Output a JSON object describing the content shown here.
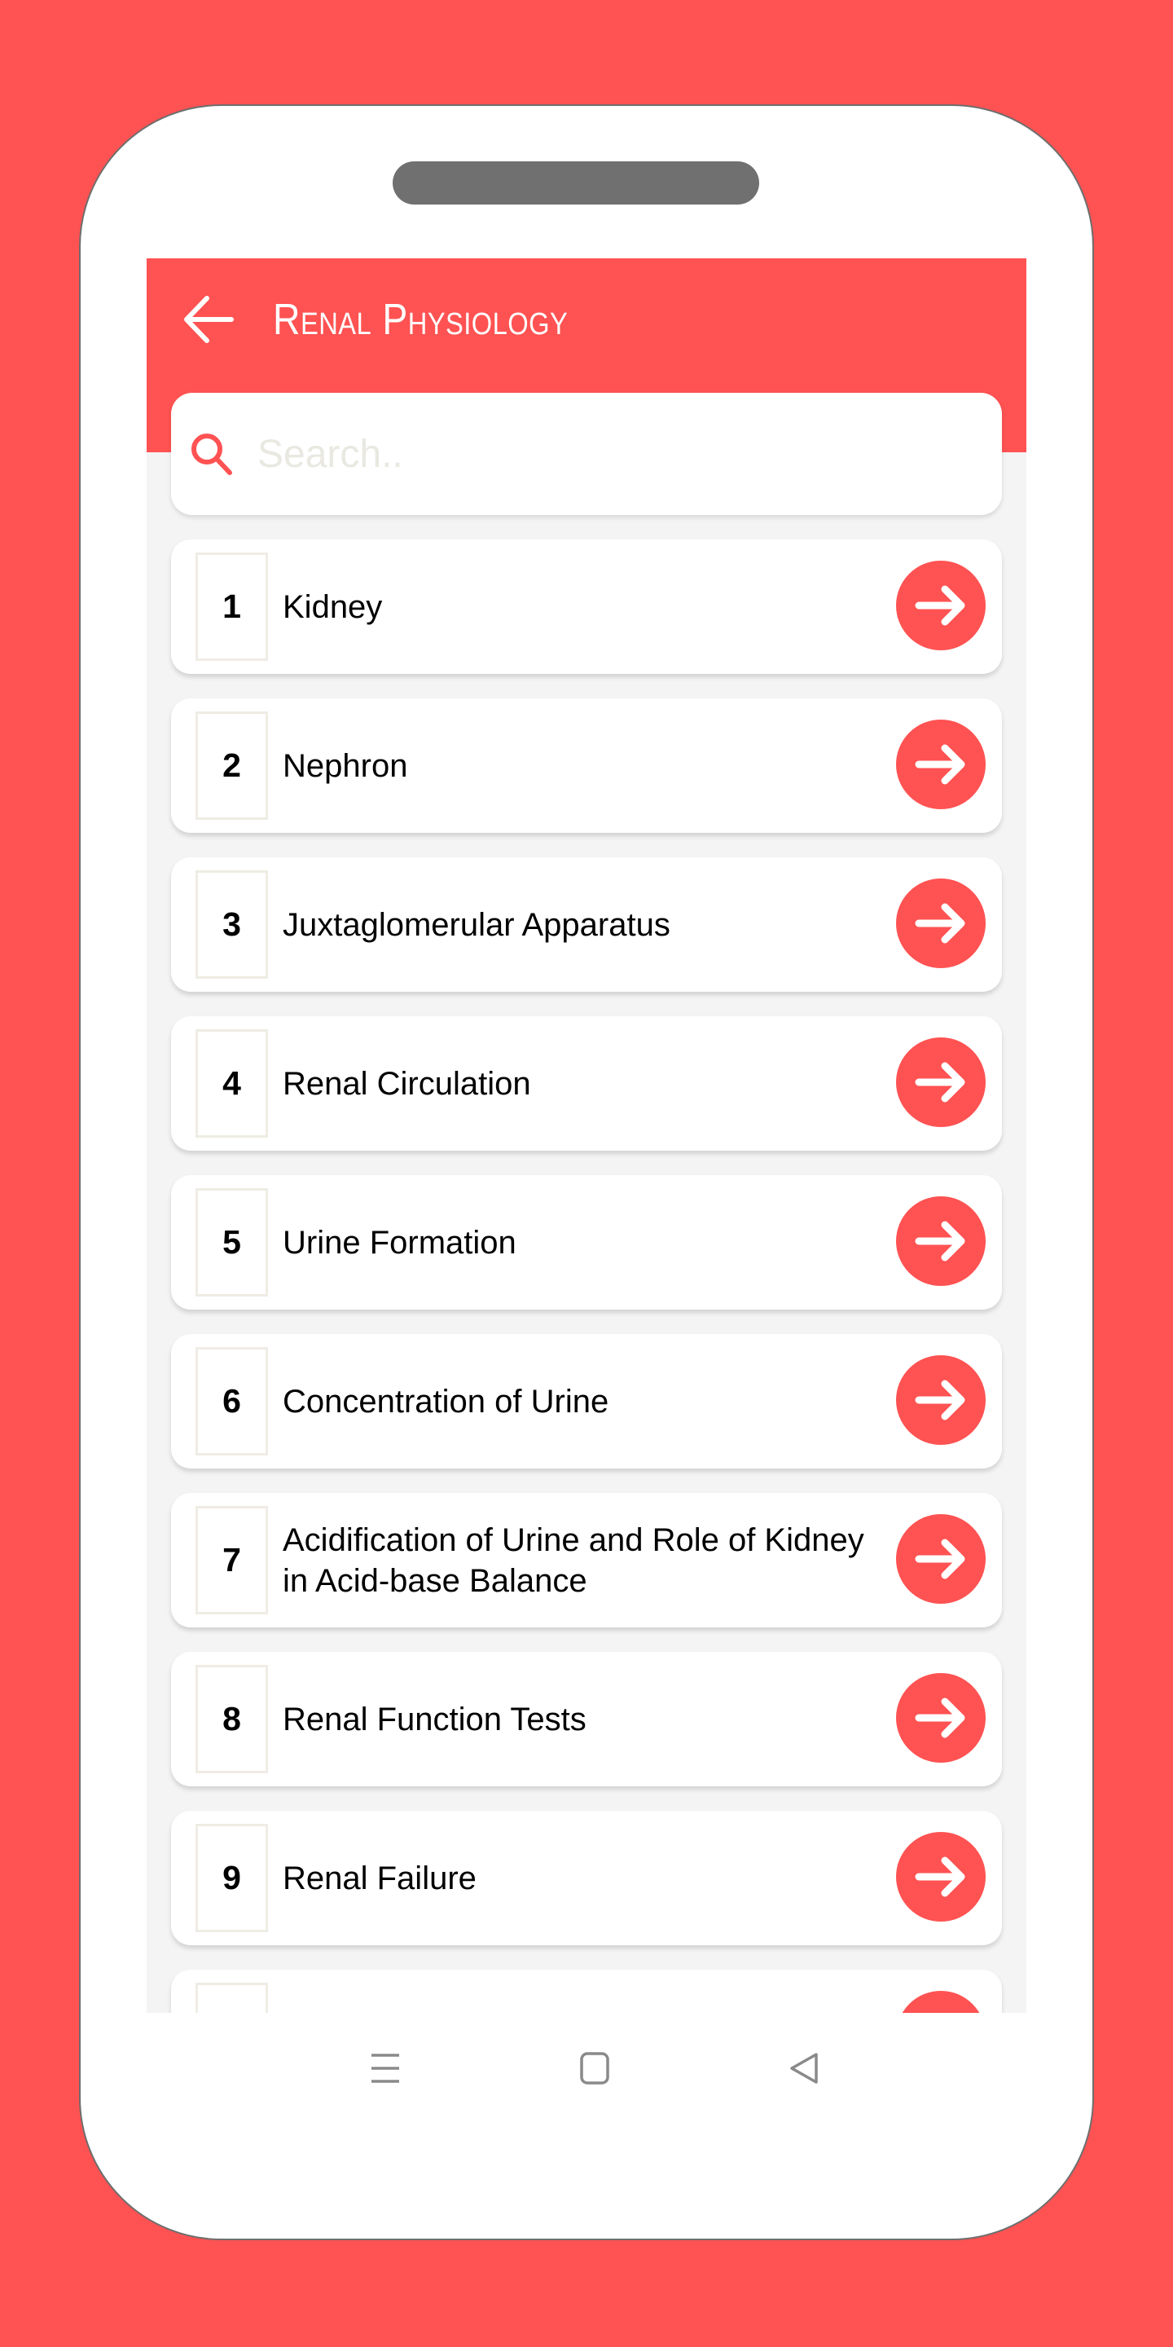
{
  "app": {
    "title": "Renal Physiology",
    "back_icon": "arrow-left-icon",
    "accent_color": "#ff5252"
  },
  "search": {
    "placeholder": "Search..",
    "value": "",
    "icon": "search-icon"
  },
  "chapters": [
    {
      "number": "1",
      "title": "Kidney"
    },
    {
      "number": "2",
      "title": "Nephron"
    },
    {
      "number": "3",
      "title": "Juxtaglomerular Apparatus"
    },
    {
      "number": "4",
      "title": "Renal Circulation"
    },
    {
      "number": "5",
      "title": "Urine Formation"
    },
    {
      "number": "6",
      "title": "Concentration of Urine"
    },
    {
      "number": "7",
      "title": "Acidification of Urine and Role of Kidney in Acid-base Balance"
    },
    {
      "number": "8",
      "title": "Renal Function Tests"
    },
    {
      "number": "9",
      "title": "Renal Failure"
    },
    {
      "number": "",
      "title": ""
    }
  ],
  "item_action_icon": "arrow-right-circle-icon",
  "system_nav": {
    "buttons": [
      {
        "name": "recent-apps",
        "icon": "menu-lines-icon"
      },
      {
        "name": "home",
        "icon": "square-icon"
      },
      {
        "name": "back",
        "icon": "triangle-back-icon"
      }
    ]
  }
}
